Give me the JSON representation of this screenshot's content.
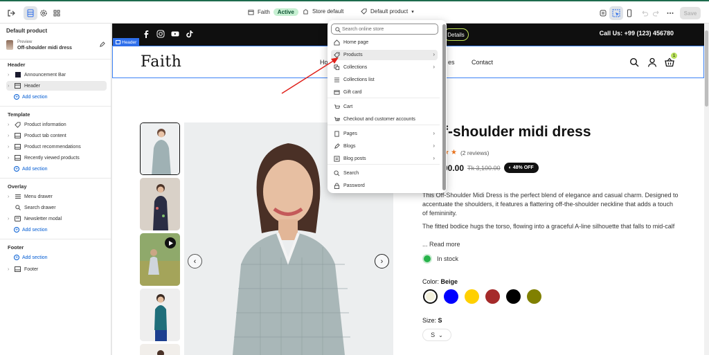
{
  "topbar": {
    "store_name": "Faith",
    "store_status": "Active",
    "theme_label": "Store default",
    "template_label": "Default product",
    "save_label": "Save"
  },
  "sidebar": {
    "title": "Default product",
    "preview_label": "Preview",
    "preview_value": "Off-shoulder midi dress",
    "add_section": "Add section",
    "groups": [
      {
        "title": "Header",
        "items": [
          "Announcement Bar",
          "Header"
        ]
      },
      {
        "title": "Template",
        "items": [
          "Product information",
          "Product tab content",
          "Product recommendations",
          "Recently viewed products"
        ]
      },
      {
        "title": "Overlay",
        "items": [
          "Menu drawer",
          "Search drawer",
          "Newsletter modal"
        ]
      },
      {
        "title": "Footer",
        "items": [
          "Footer"
        ]
      }
    ]
  },
  "preview": {
    "announcement": {
      "details_label": "Details",
      "call_text": "Call Us: +99 (123) 456780"
    },
    "header_tag": "Header",
    "logo": "Faith",
    "nav": [
      "Ho",
      "es",
      "Contact"
    ],
    "cart_count": "1",
    "product": {
      "title": "f-shoulder midi dress",
      "reviews": "(2 reviews)",
      "price": "00.00",
      "old_price": "Tk 3,100.00",
      "discount": "48% OFF",
      "description_1": "This Off-Shoulder Midi Dress is the perfect blend of elegance and casual charm. Designed to accentuate the shoulders, it features a flattering off-the-shoulder neckline that adds a touch of femininity.",
      "description_2": "The fitted bodice hugs the torso, flowing into a graceful A-line silhouette that falls to mid-calf",
      "read_more": "... Read more",
      "stock": "In stock",
      "color_label": "Color:",
      "color_value": "Beige",
      "colors": [
        "#f3f1dc",
        "#0000ff",
        "#ffd000",
        "#a52a2a",
        "#000000",
        "#808000"
      ],
      "size_label": "Size:",
      "size_value": "S",
      "size_select": "S"
    }
  },
  "link_menu": {
    "search_placeholder": "Search online store",
    "items": [
      {
        "label": "Home page",
        "icon": "home-icon",
        "arrow": false
      },
      {
        "label": "Products",
        "icon": "tag-icon",
        "arrow": true,
        "highlight": true
      },
      {
        "label": "Collections",
        "icon": "collection-icon",
        "arrow": true
      },
      {
        "label": "Collections list",
        "icon": "list-icon",
        "arrow": false
      },
      {
        "label": "Gift card",
        "icon": "gift-card-icon",
        "arrow": false
      },
      {
        "label": "Cart",
        "icon": "cart-icon",
        "arrow": false
      },
      {
        "label": "Checkout and customer accounts",
        "icon": "checkout-icon",
        "arrow": false
      },
      {
        "label": "Pages",
        "icon": "page-icon",
        "arrow": true
      },
      {
        "label": "Blogs",
        "icon": "blog-icon",
        "arrow": true
      },
      {
        "label": "Blog posts",
        "icon": "blog-post-icon",
        "arrow": true
      },
      {
        "label": "Search",
        "icon": "search-icon",
        "arrow": false
      },
      {
        "label": "Password",
        "icon": "lock-icon",
        "arrow": false
      }
    ]
  },
  "colors": {
    "accent": "#005bd3",
    "selection_border": "#3b82f6",
    "annotation_arrow": "#e0211b"
  }
}
